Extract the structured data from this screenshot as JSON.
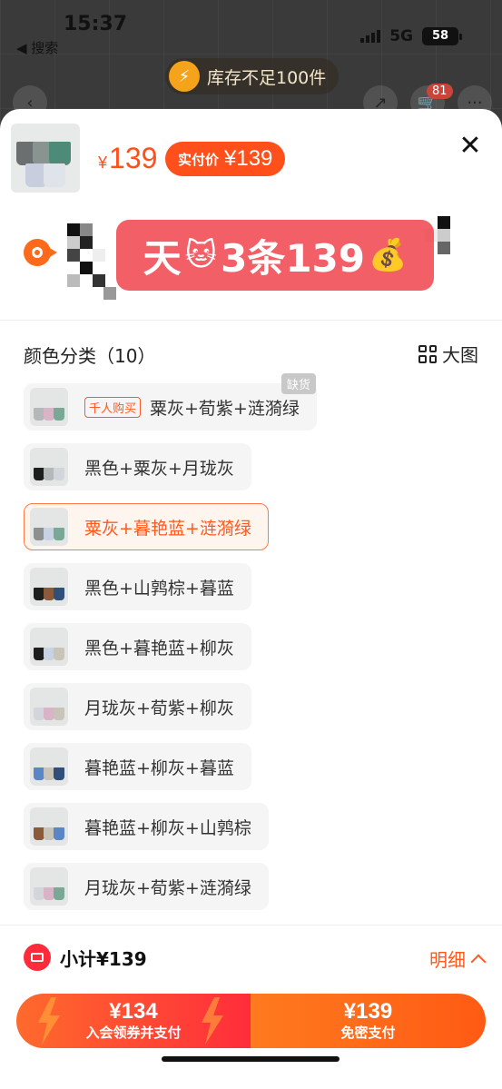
{
  "status_bar": {
    "time": "15:37",
    "back_label": "◀ 搜索",
    "network": "5G",
    "battery": "58"
  },
  "background": {
    "stock_notice": "库存不足100件",
    "cart_count": "81"
  },
  "product": {
    "price_currency": "¥",
    "price": "139",
    "pay_badge_label": "实付价",
    "pay_badge_value": "¥139"
  },
  "promo": {
    "text_prefix": "天",
    "emoji_cat": "🐱",
    "text_main": "3条139",
    "emoji_money": "💰"
  },
  "color_section": {
    "title": "颜色分类（10）",
    "big_view_label": "大图",
    "options": [
      {
        "label": "粟灰+荀紫+涟漪绿",
        "tag": "千人购买",
        "status": "缺货",
        "selected": false
      },
      {
        "label": "黑色+粟灰+月珑灰",
        "selected": false
      },
      {
        "label": "粟灰+暮艳蓝+涟漪绿",
        "selected": true
      },
      {
        "label": "黑色+山鹑棕+暮蓝",
        "selected": false
      },
      {
        "label": "黑色+暮艳蓝+柳灰",
        "selected": false
      },
      {
        "label": "月珑灰+荀紫+柳灰",
        "selected": false
      },
      {
        "label": "暮艳蓝+柳灰+暮蓝",
        "selected": false
      },
      {
        "label": "暮艳蓝+柳灰+山鹑棕",
        "selected": false
      },
      {
        "label": "月珑灰+荀紫+涟漪绿",
        "selected": false
      }
    ]
  },
  "footer": {
    "subtotal": "小计¥139",
    "detail_label": "明细",
    "member_pay_amount": "¥134",
    "member_pay_label": "入会领券并支付",
    "quick_pay_amount": "¥139",
    "quick_pay_label": "免密支付"
  },
  "colors": {
    "accent": "#ff5a1f",
    "promo_red": "#f03c46"
  }
}
